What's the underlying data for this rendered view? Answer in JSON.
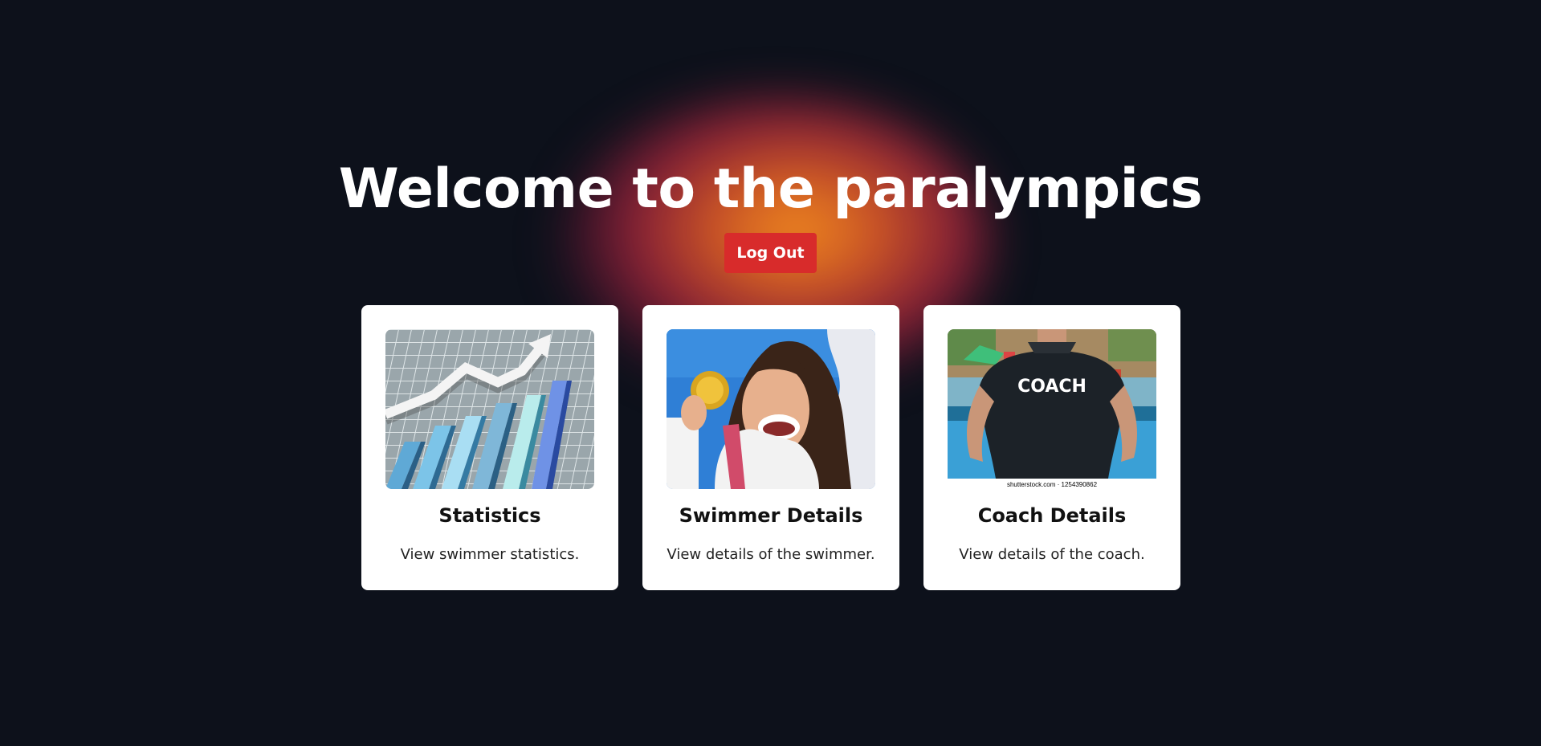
{
  "hero": {
    "title": "Welcome to the paralympics",
    "logout_label": "Log Out"
  },
  "cards": [
    {
      "title": "Statistics",
      "description": "View swimmer statistics.",
      "image": "bar-chart-growth-icon"
    },
    {
      "title": "Swimmer Details",
      "description": "View details of the swimmer.",
      "image": "gold-medal-swimmer-photo"
    },
    {
      "title": "Coach Details",
      "description": "View details of the coach.",
      "image": "coach-shirt-photo",
      "image_text": "COACH",
      "image_caption": "shutterstock.com · 1254390862"
    }
  ],
  "colors": {
    "background": "#0d111b",
    "logout": "#d82b2b",
    "card": "#ffffff"
  }
}
